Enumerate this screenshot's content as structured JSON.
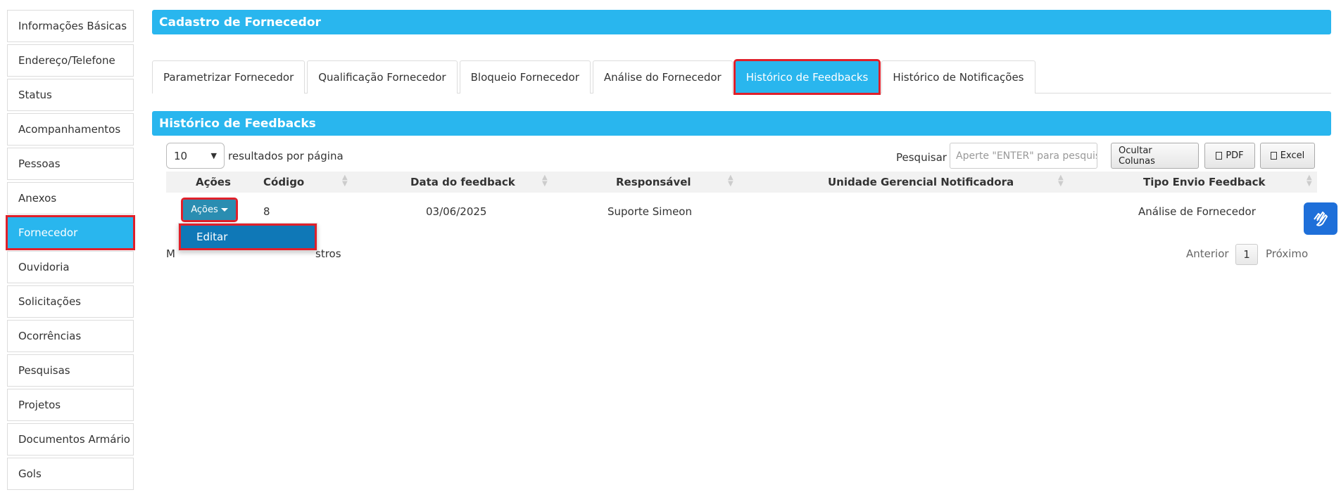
{
  "sidebar": {
    "items": [
      {
        "label": "Informações Básicas"
      },
      {
        "label": "Endereço/Telefone"
      },
      {
        "label": "Status"
      },
      {
        "label": "Acompanhamentos"
      },
      {
        "label": "Pessoas"
      },
      {
        "label": "Anexos"
      },
      {
        "label": "Fornecedor"
      },
      {
        "label": "Ouvidoria"
      },
      {
        "label": "Solicitações"
      },
      {
        "label": "Ocorrências"
      },
      {
        "label": "Pesquisas"
      },
      {
        "label": "Projetos"
      },
      {
        "label": "Documentos Armário"
      },
      {
        "label": "Gols"
      }
    ],
    "active": "Fornecedor"
  },
  "header": {
    "title": "Cadastro de Fornecedor"
  },
  "tabs": [
    {
      "label": "Parametrizar Fornecedor"
    },
    {
      "label": "Qualificação Fornecedor"
    },
    {
      "label": "Bloqueio Fornecedor"
    },
    {
      "label": "Análise do Fornecedor"
    },
    {
      "label": "Histórico de Feedbacks"
    },
    {
      "label": "Histórico de Notificações"
    }
  ],
  "active_tab": "Histórico de Feedbacks",
  "section": {
    "title": "Histórico de Feedbacks"
  },
  "toolbar": {
    "page_length": "10",
    "page_length_label": "resultados por página",
    "search_label": "Pesquisar",
    "search_placeholder": "Aperte \"ENTER\" para pesquisar",
    "hide_columns_label": "Ocultar Colunas",
    "pdf_label": "PDF",
    "excel_label": "Excel"
  },
  "table": {
    "columns": [
      "Ações",
      "Código",
      "Data do feedback",
      "Responsável",
      "Unidade Gerencial Notificadora",
      "Tipo Envio Feedback"
    ],
    "rows": [
      {
        "acoes": "Ações",
        "codigo": "8",
        "data": "03/06/2025",
        "responsavel": "Suporte Simeon",
        "unidade": "",
        "tipo": "Análise de Fornecedor"
      }
    ],
    "dropdown": {
      "items": [
        {
          "label": "Editar"
        }
      ]
    }
  },
  "footer": {
    "info_prefix": "M",
    "info_suffix": "stros",
    "prev_label": "Anterior",
    "page": "1",
    "next_label": "Próximo"
  },
  "colors": {
    "accent": "#29b6ee",
    "highlight": "#e0202a",
    "button": "#2a8db1"
  }
}
